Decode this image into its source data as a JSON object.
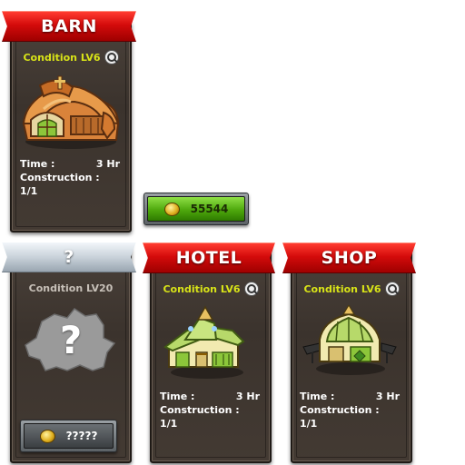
{
  "buildings": [
    {
      "name": "BARN",
      "condition": "Condition LV6",
      "time_label": "Time :",
      "time_value": "3 Hr",
      "construction": "Construction : 1/1",
      "ribbon_color": "#d40b0b"
    },
    {
      "name": "?",
      "condition": "Condition LV20",
      "locked_mark": "?",
      "cost": "?????",
      "ribbon_color": "#c9d2da"
    },
    {
      "name": "HOTEL",
      "condition": "Condition LV6",
      "time_label": "Time :",
      "time_value": "3 Hr",
      "construction": "Construction : 1/1",
      "ribbon_color": "#d40b0b"
    },
    {
      "name": "SHOP",
      "condition": "Condition LV6",
      "time_label": "Time :",
      "time_value": "3 Hr",
      "construction": "Construction : 1/1",
      "ribbon_color": "#d40b0b"
    }
  ],
  "barn_cost": "55544",
  "icons": {
    "zoom": "magnifier-icon",
    "coin": "gold-coin-icon"
  },
  "colors": {
    "condition_met": "#d8e318",
    "condition_locked": "#c7c0b8",
    "cost_affordable": "#4ea80d"
  }
}
